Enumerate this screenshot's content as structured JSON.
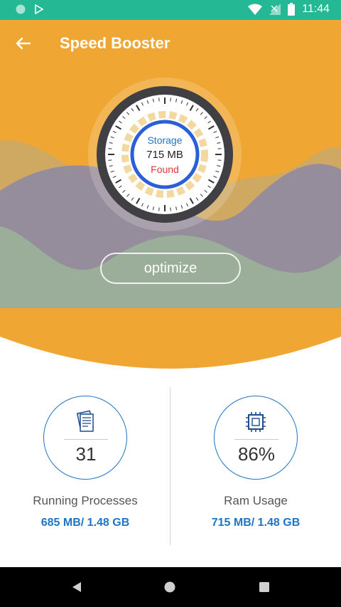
{
  "status_bar": {
    "time": "11:44",
    "icons": [
      "circle-notification-icon",
      "play-store-icon",
      "wifi-icon",
      "signal-icon",
      "battery-icon"
    ]
  },
  "header": {
    "title": "Speed Booster",
    "back_icon": "arrow-left-icon"
  },
  "gauge": {
    "line1": "Storage",
    "value": "715 MB",
    "line3": "Found"
  },
  "action": {
    "optimize_label": "optimize"
  },
  "stats": {
    "processes": {
      "icon": "document-list-icon",
      "value": "31",
      "label": "Running Processes",
      "sub": "685 MB/ 1.48 GB"
    },
    "ram": {
      "icon": "cpu-chip-icon",
      "value": "86%",
      "label": "Ram Usage",
      "sub": "715 MB/ 1.48 GB"
    }
  },
  "nav": {
    "icons": [
      "back-triangle-icon",
      "home-circle-icon",
      "recents-square-icon"
    ]
  },
  "colors": {
    "status_bar": "#25b895",
    "hero": "#f0a632",
    "accent_blue": "#1f74c4",
    "found_red": "#e0383c"
  }
}
